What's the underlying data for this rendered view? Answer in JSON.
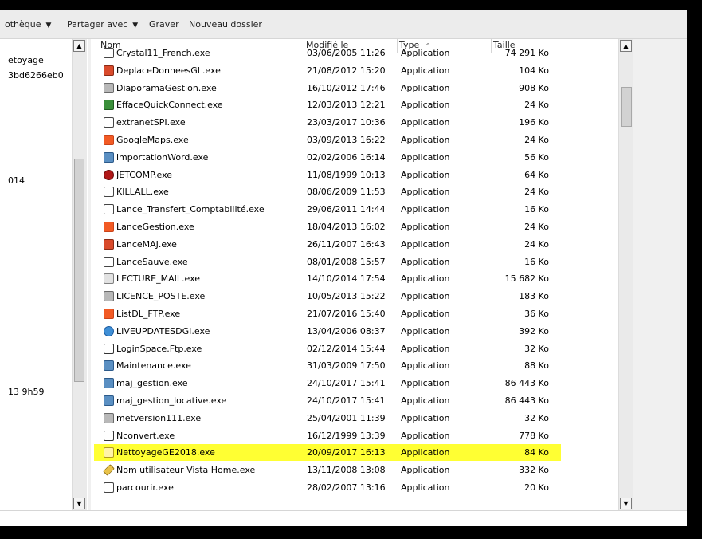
{
  "toolbar": {
    "library": "othèque",
    "share": "Partager avec",
    "burn": "Graver",
    "new_folder": "Nouveau dossier"
  },
  "nav": {
    "items": [
      "etoyage",
      "3bd6266eb0",
      "014",
      "13 9h59"
    ]
  },
  "columns": {
    "name": "Nom",
    "modified": "Modifié le",
    "type": "Type",
    "size": "Taille",
    "sort_indicator": "^"
  },
  "files": [
    {
      "name": "Crystal11_French.exe",
      "modified": "03/06/2005 11:26",
      "type": "Application",
      "size": "74 291 Ko",
      "icon": "app-icon"
    },
    {
      "name": "DeplaceDonneesGL.exe",
      "modified": "21/08/2012 15:20",
      "type": "Application",
      "size": "104 Ko",
      "icon": "house-icon"
    },
    {
      "name": "DiaporamaGestion.exe",
      "modified": "16/10/2012 17:46",
      "type": "Application",
      "size": "908 Ko",
      "icon": "slideshow-icon"
    },
    {
      "name": "EffaceQuickConnect.exe",
      "modified": "12/03/2013 12:21",
      "type": "Application",
      "size": "24 Ko",
      "icon": "people-icon"
    },
    {
      "name": "extranetSPI.exe",
      "modified": "23/03/2017 10:36",
      "type": "Application",
      "size": "196 Ko",
      "icon": "app-icon"
    },
    {
      "name": "GoogleMaps.exe",
      "modified": "03/09/2013 16:22",
      "type": "Application",
      "size": "24 Ko",
      "icon": "orange-square-icon"
    },
    {
      "name": "importationWord.exe",
      "modified": "02/02/2006 16:14",
      "type": "Application",
      "size": "56 Ko",
      "icon": "word-icon"
    },
    {
      "name": "JETCOMP.exe",
      "modified": "11/08/1999 10:13",
      "type": "Application",
      "size": "64 Ko",
      "icon": "jet-icon"
    },
    {
      "name": "KILLALL.exe",
      "modified": "08/06/2009 11:53",
      "type": "Application",
      "size": "24 Ko",
      "icon": "app-icon"
    },
    {
      "name": "Lance_Transfert_Comptabilité.exe",
      "modified": "29/06/2011 14:44",
      "type": "Application",
      "size": "16 Ko",
      "icon": "app-icon"
    },
    {
      "name": "LanceGestion.exe",
      "modified": "18/04/2013 16:02",
      "type": "Application",
      "size": "24 Ko",
      "icon": "orange-square-icon"
    },
    {
      "name": "LanceMAJ.exe",
      "modified": "26/11/2007 16:43",
      "type": "Application",
      "size": "24 Ko",
      "icon": "house-icon"
    },
    {
      "name": "LanceSauve.exe",
      "modified": "08/01/2008 15:57",
      "type": "Application",
      "size": "16 Ko",
      "icon": "app-icon"
    },
    {
      "name": "LECTURE_MAIL.exe",
      "modified": "14/10/2014 17:54",
      "type": "Application",
      "size": "15 682 Ko",
      "icon": "mail-icon"
    },
    {
      "name": "LICENCE_POSTE.exe",
      "modified": "10/05/2013 15:22",
      "type": "Application",
      "size": "183 Ko",
      "icon": "monitor-icon"
    },
    {
      "name": "ListDL_FTP.exe",
      "modified": "21/07/2016 15:40",
      "type": "Application",
      "size": "36 Ko",
      "icon": "orange-square-icon"
    },
    {
      "name": "LIVEUPDATESDGI.exe",
      "modified": "13/04/2006 08:37",
      "type": "Application",
      "size": "392 Ko",
      "icon": "globe-icon"
    },
    {
      "name": "LoginSpace.Ftp.exe",
      "modified": "02/12/2014 15:44",
      "type": "Application",
      "size": "32 Ko",
      "icon": "window-icon"
    },
    {
      "name": "Maintenance.exe",
      "modified": "31/03/2009 17:50",
      "type": "Application",
      "size": "88 Ko",
      "icon": "tools-icon"
    },
    {
      "name": "maj_gestion.exe",
      "modified": "24/10/2017 15:41",
      "type": "Application",
      "size": "86 443 Ko",
      "icon": "computers-icon"
    },
    {
      "name": "maj_gestion_locative.exe",
      "modified": "24/10/2017 15:41",
      "type": "Application",
      "size": "86 443 Ko",
      "icon": "computers-icon"
    },
    {
      "name": "metversion111.exe",
      "modified": "25/04/2001 11:39",
      "type": "Application",
      "size": "32 Ko",
      "icon": "wand-icon"
    },
    {
      "name": "Nconvert.exe",
      "modified": "16/12/1999 13:39",
      "type": "Application",
      "size": "778 Ko",
      "icon": "console-icon"
    },
    {
      "name": "NettoyageGE2018.exe",
      "modified": "20/09/2017 16:13",
      "type": "Application",
      "size": "84 Ko",
      "icon": "certificate-icon",
      "selected": true
    },
    {
      "name": "Nom utilisateur Vista Home.exe",
      "modified": "13/11/2008 13:08",
      "type": "Application",
      "size": "332 Ko",
      "icon": "pencil-icon"
    },
    {
      "name": "parcourir.exe",
      "modified": "28/02/2007 13:16",
      "type": "Application",
      "size": "20 Ko",
      "icon": "app-icon"
    }
  ],
  "colors": {
    "selection_highlight": "#ffff33"
  }
}
